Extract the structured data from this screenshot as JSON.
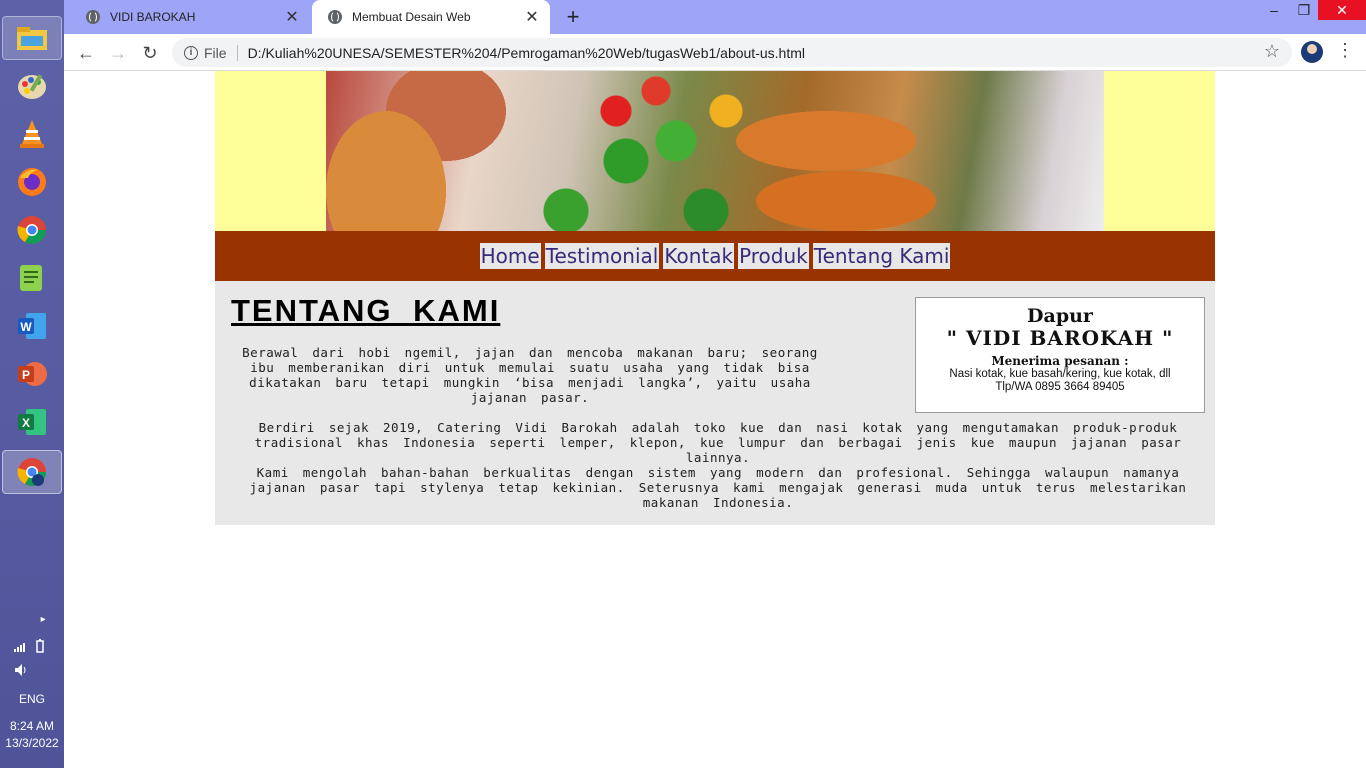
{
  "taskbar": {
    "icons": [
      "file-explorer-icon",
      "paint-icon",
      "vlc-icon",
      "firefox-icon",
      "chrome-icon",
      "notepadpp-icon",
      "word-icon",
      "powerpoint-icon",
      "excel-icon",
      "chrome-profile-icon"
    ],
    "language": "ENG",
    "time": "8:24 AM",
    "date": "13/3/2022"
  },
  "browser": {
    "tabs": [
      {
        "label": "VIDI BAROKAH",
        "active": false
      },
      {
        "label": "Membuat Desain Web",
        "active": true
      }
    ],
    "new_tab": "+",
    "window_controls": {
      "minimize": "–",
      "restore": "❐",
      "close": "✕"
    },
    "nav": {
      "back": "←",
      "forward": "→",
      "reload": "↻"
    },
    "address": {
      "scheme_label": "File",
      "url": "D:/Kuliah%20UNESA/SEMESTER%204/Pemrogaman%20Web/tugasWeb1/about-us.html",
      "info_glyph": "i"
    },
    "bookmark_star": "☆",
    "menu_glyph": "⋮"
  },
  "site": {
    "nav": [
      "Home",
      "Testimonial",
      "Kontak",
      "Produk",
      "Tentang Kami"
    ],
    "title": "TENTANG  KAMI",
    "paragraphs": [
      "Berawal dari hobi ngemil, jajan dan mencoba makanan baru; seorang ibu memberanikan diri untuk memulai suatu usaha yang tidak bisa dikatakan baru tetapi mungkin ‘bisa menjadi langka’, yaitu usaha jajanan pasar.",
      "Berdiri sejak 2019, Catering Vidi Barokah adalah toko kue dan nasi kotak yang mengutamakan produk-produk tradisional khas Indonesia seperti lemper, klepon, kue lumpur dan berbagai jenis kue maupun jajanan pasar lainnya.",
      "Kami mengolah bahan-bahan berkualitas dengan sistem yang modern dan profesional. Sehingga walaupun namanya jajanan pasar tapi stylenya tetap kekinian. Seterusnya kami mengajak generasi muda untuk terus melestarikan makanan Indonesia."
    ],
    "promo": {
      "line1": "Dapur",
      "line2": "\" VIDI BAROKAH \"",
      "line3": "Menerima pesanan :",
      "line4": "Nasi kotak, kue basah/kering, kue kotak, dll",
      "line5": "Tlp/WA 0895 3664 89405"
    },
    "colors": {
      "header_bg": "#ffff99",
      "nav_bg": "#993300",
      "content_bg": "#e8e8e8",
      "nav_link_bg": "#e7e7e7",
      "nav_link_text": "#3a2a7a"
    }
  }
}
